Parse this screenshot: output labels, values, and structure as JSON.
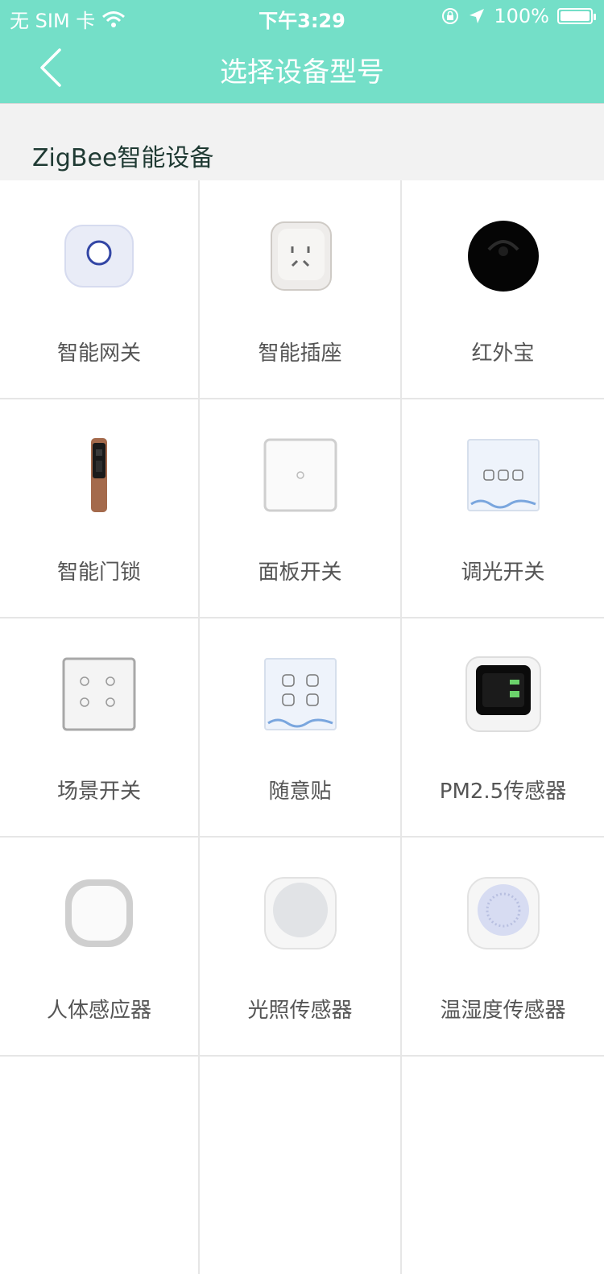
{
  "status_bar": {
    "carrier": "无 SIM 卡",
    "time": "下午3:29",
    "battery": "100%"
  },
  "nav": {
    "title": "选择设备型号"
  },
  "section": {
    "title": "ZigBee智能设备"
  },
  "devices": [
    {
      "name": "智能网关",
      "icon": "gateway-icon"
    },
    {
      "name": "智能插座",
      "icon": "socket-icon"
    },
    {
      "name": "红外宝",
      "icon": "ir-remote-icon"
    },
    {
      "name": "智能门锁",
      "icon": "door-lock-icon"
    },
    {
      "name": "面板开关",
      "icon": "panel-switch-icon"
    },
    {
      "name": "调光开关",
      "icon": "dimmer-switch-icon"
    },
    {
      "name": "场景开关",
      "icon": "scene-switch-icon"
    },
    {
      "name": "随意贴",
      "icon": "sticker-switch-icon"
    },
    {
      "name": "PM2.5传感器",
      "icon": "pm25-sensor-icon"
    },
    {
      "name": "人体感应器",
      "icon": "motion-sensor-icon"
    },
    {
      "name": "光照传感器",
      "icon": "light-sensor-icon"
    },
    {
      "name": "温湿度传感器",
      "icon": "temp-humidity-sensor-icon"
    }
  ]
}
